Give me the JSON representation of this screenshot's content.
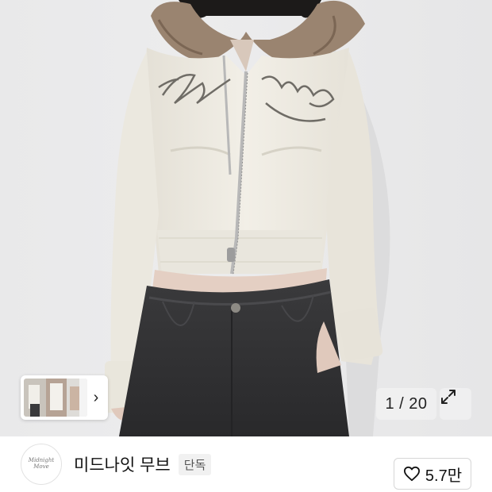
{
  "gallery": {
    "counter_current": "1",
    "counter_separator": " / ",
    "counter_total": "20",
    "thumbnail_next_glyph": "›",
    "expand_icon": "expand-icon"
  },
  "shop": {
    "logo_text": "Midnight Move",
    "name": "미드나잇 무브",
    "badge": "단독"
  },
  "like": {
    "icon": "heart-outline-icon",
    "count": "5.7만"
  },
  "colors": {
    "background": "#e9e9ea",
    "hoodie": "#efece3",
    "fur": "#9a8470",
    "jeans": "#2e2e30"
  }
}
